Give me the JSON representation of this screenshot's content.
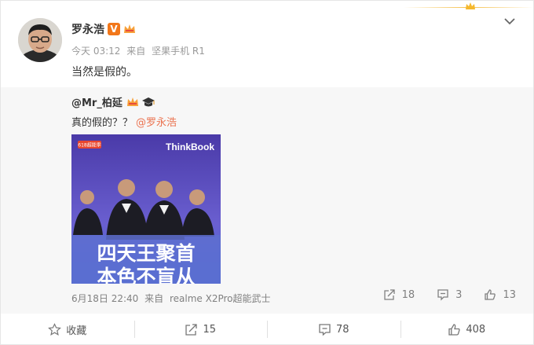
{
  "post": {
    "author_name": "罗永浩",
    "verified_badge": "V",
    "time": "今天 03:12",
    "source_prefix": "来自",
    "source_device": "坚果手机 R1",
    "text": "当然是假的。"
  },
  "repost": {
    "user_name": "@Mr_柏延",
    "text": "真的假的？？",
    "mention": "@罗永浩",
    "image_brand": "ThinkBook",
    "image_tag": "618超能季",
    "image_headline_1": "四天王聚首",
    "image_headline_2": "本色不盲从",
    "date": "6月18日 22:40",
    "source_prefix": "来自",
    "source_device": "realme X2Pro超能武士",
    "forward_count": "18",
    "comment_count": "3",
    "like_count": "13"
  },
  "actions": {
    "favorite_label": "收藏",
    "forward_count": "15",
    "comment_count": "78",
    "like_count": "408"
  },
  "colors": {
    "mention": "#eb7350",
    "vbadge": "#f2771a",
    "repost_bg": "#f7f7f7"
  }
}
